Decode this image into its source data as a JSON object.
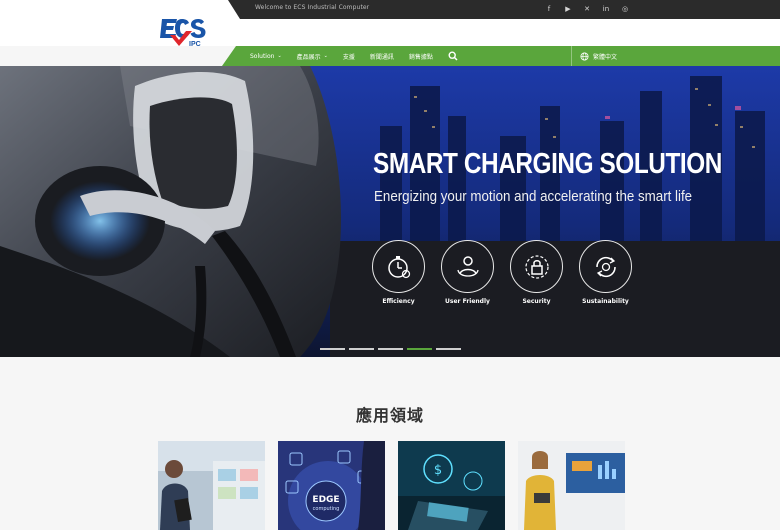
{
  "topbar": {
    "welcome": "Welcome to ECS Industrial Computer",
    "socials": [
      {
        "icon": "facebook-icon",
        "glyph": "f"
      },
      {
        "icon": "youtube-icon",
        "glyph": "▶"
      },
      {
        "icon": "x-icon",
        "glyph": "✕"
      },
      {
        "icon": "linkedin-icon",
        "glyph": "in"
      },
      {
        "icon": "instagram-icon",
        "glyph": "◎"
      }
    ]
  },
  "logo": {
    "brand": "ECS",
    "sub": "IPC"
  },
  "nav": {
    "items": [
      {
        "label": "Solution",
        "has_dropdown": true
      },
      {
        "label": "產品展示",
        "has_dropdown": true
      },
      {
        "label": "支援",
        "has_dropdown": false
      },
      {
        "label": "新聞通訊",
        "has_dropdown": false
      },
      {
        "label": "銷售據點",
        "has_dropdown": false
      }
    ],
    "language": "繁體中文"
  },
  "hero": {
    "title": "SMART CHARGING SOLUTION",
    "subtitle": "Energizing your motion and accelerating the smart life",
    "features": [
      {
        "label": "Efficiency",
        "icon": "stopwatch-gear-icon"
      },
      {
        "label": "User Friendly",
        "icon": "user-friendly-icon"
      },
      {
        "label": "Security",
        "icon": "lock-shield-icon"
      },
      {
        "label": "Sustainability",
        "icon": "recycle-icon"
      }
    ],
    "slides_total": 5,
    "active_slide": 4
  },
  "applications": {
    "title": "應用領域",
    "cards": [
      {
        "name": "retail-card"
      },
      {
        "name": "edge-computing-card",
        "overlay_text": "EDGE",
        "overlay_sub": "computing"
      },
      {
        "name": "fintech-card"
      },
      {
        "name": "signage-card"
      }
    ]
  },
  "colors": {
    "accent": "#5aa63c",
    "topbar": "#2b2b2b",
    "logo_blue": "#1a55a8",
    "logo_red": "#e0262c"
  }
}
